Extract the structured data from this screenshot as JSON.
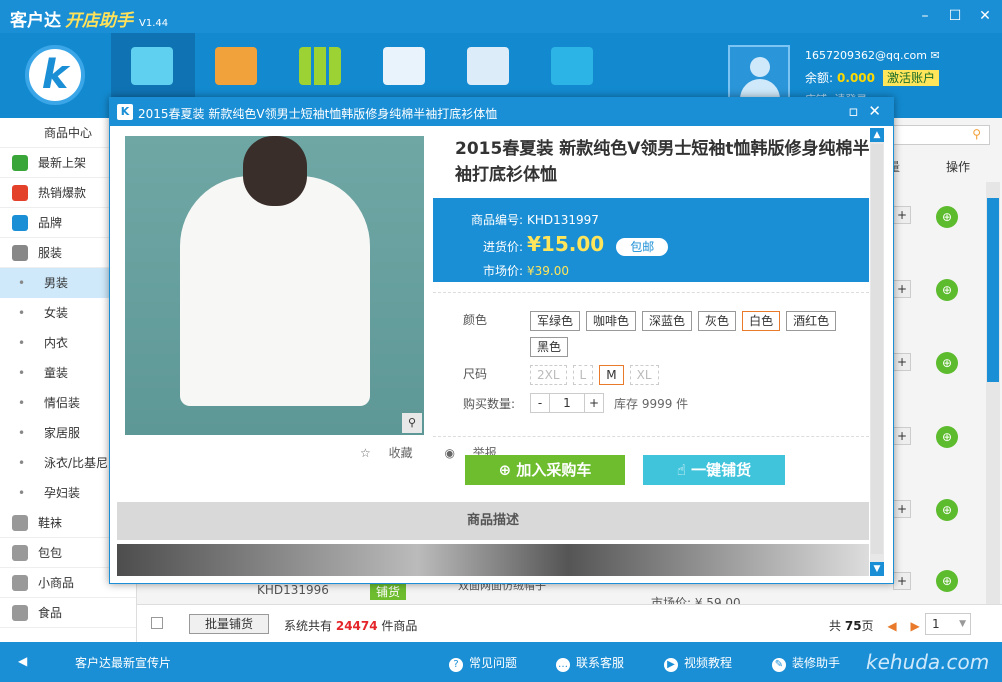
{
  "app": {
    "name": "客户达",
    "subtitle": "开店助手",
    "version": "V1.44",
    "window_controls": [
      "–",
      "☐",
      "✕"
    ]
  },
  "toolbar": {
    "tools": [
      "upload-icon",
      "package-icon",
      "grid-icon",
      "shop-icon",
      "profile-card-icon",
      "toolbox-icon"
    ]
  },
  "user": {
    "email": "1657209362@qq.com",
    "balance_label": "余额:",
    "balance": "0.000",
    "activate": "激活账户",
    "shop_label": "店铺:",
    "shop_value": "请登录"
  },
  "sidebar": {
    "header": "商品中心",
    "categories": [
      {
        "label": "最新上架",
        "icon": "new-icon",
        "color": "#3aa63a"
      },
      {
        "label": "热销爆款",
        "icon": "fire-icon",
        "color": "#e4412b"
      },
      {
        "label": "品牌",
        "icon": "thumb-up-icon",
        "color": "#1a8fd6"
      },
      {
        "label": "服装",
        "icon": "shirt-icon",
        "color": "#777777"
      }
    ],
    "subitems": [
      "男装",
      "女装",
      "内衣",
      "童装",
      "情侣装",
      "家居服",
      "泳衣/比基尼",
      "孕妇装"
    ],
    "more": [
      {
        "label": "鞋袜",
        "icon": "shoe-icon"
      },
      {
        "label": "包包",
        "icon": "bag-icon"
      },
      {
        "label": "小商品",
        "icon": "gift-icon"
      },
      {
        "label": "食品",
        "icon": "food-icon"
      }
    ]
  },
  "list": {
    "op_header": "操作",
    "partial_header": "量",
    "row_code": "KHD131996",
    "row_tag": "铺货",
    "row_market": "市场价: ¥ 59.00",
    "row_title": "双面网面仿绒帽子"
  },
  "bottom": {
    "batch": "批量铺货",
    "total_pre": "系统共有",
    "total_n": "24474",
    "total_post": "件商品",
    "pages_pre": "共",
    "pages_n": "75",
    "pages_post": "页",
    "page_sel": "1"
  },
  "status": {
    "promo": "客户达最新宣传片",
    "faq": "常见问题",
    "contact": "联系客服",
    "video": "视频教程",
    "decorate": "装修助手",
    "brand": "kehuda.com"
  },
  "dialog": {
    "title": "2015春夏装 新款纯色V领男士短袖t恤韩版修身纯棉半袖打底衫体恤",
    "product_title": "2015春夏装  新款纯色V领男士短袖t恤韩版修身纯棉半袖打底衫体恤",
    "code_label": "商品编号:",
    "code": "KHD131997",
    "cost_label": "进货价:",
    "cost": "¥15.00",
    "ship": "包邮",
    "market_label": "市场价:",
    "market": "¥39.00",
    "color_label": "颜色",
    "colors": [
      "军绿色",
      "咖啡色",
      "深蓝色",
      "灰色",
      "白色",
      "酒红色",
      "黑色"
    ],
    "color_selected": "白色",
    "size_label": "尺码",
    "sizes": [
      "2XL",
      "L",
      "M",
      "XL"
    ],
    "size_selected": "M",
    "qty_label": "购买数量:",
    "qty": "1",
    "stock": "库存 9999 件",
    "favorite": "收藏",
    "report": "举报",
    "add_cart": "加入采购车",
    "one_click": "一键铺货",
    "desc": "商品描述"
  }
}
